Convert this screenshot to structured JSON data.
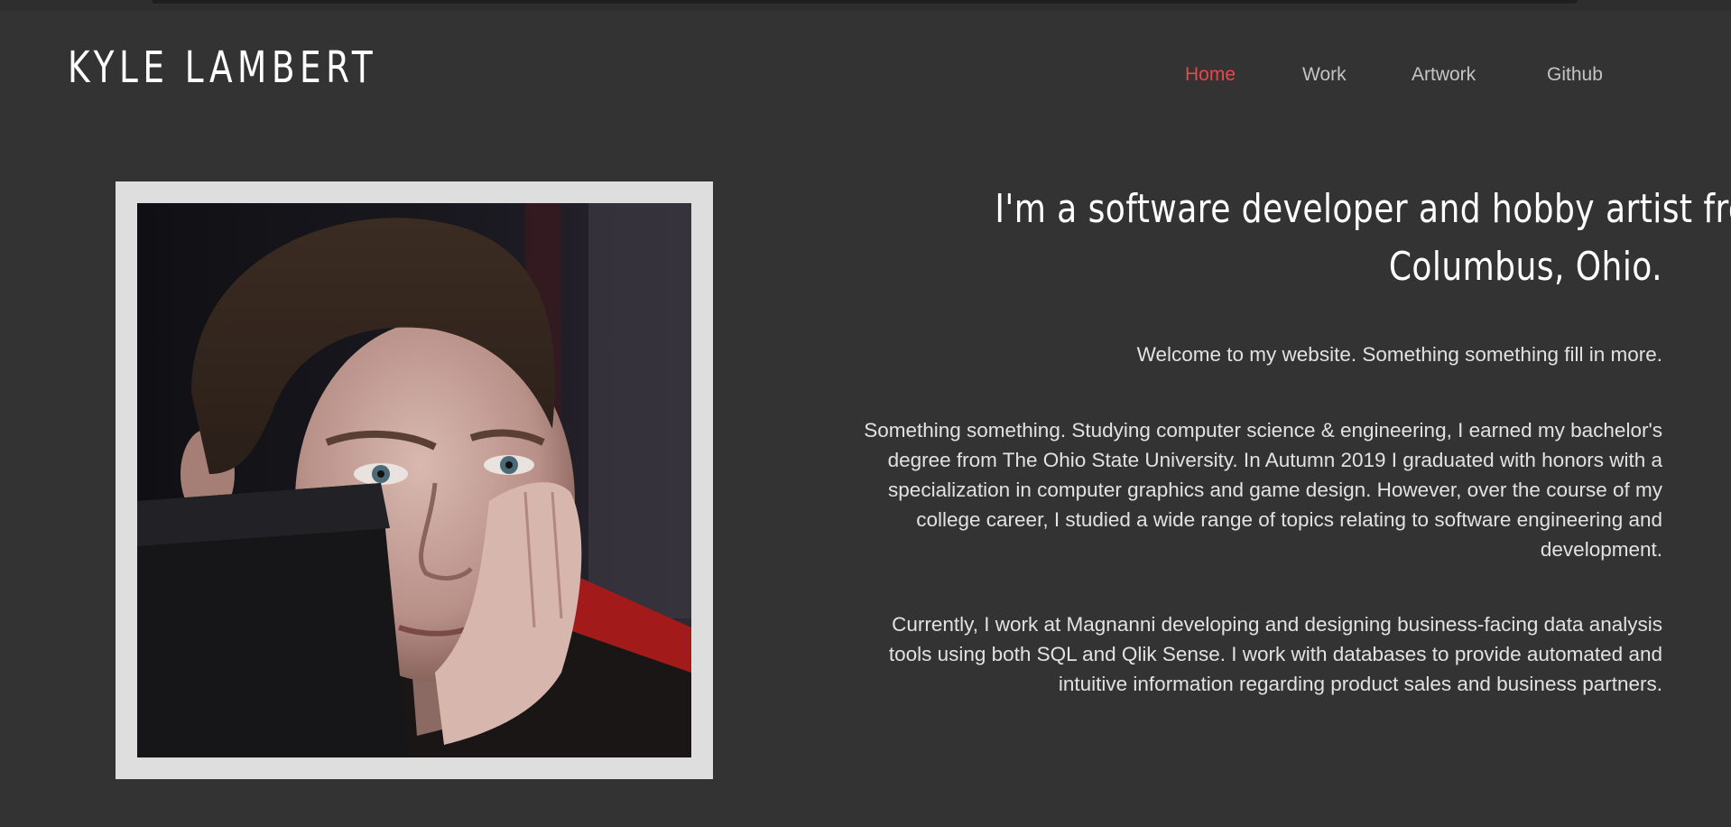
{
  "header": {
    "site_title": "KYLE LAMBERT"
  },
  "nav": {
    "items": [
      {
        "label": "Home",
        "active": true
      },
      {
        "label": "Work",
        "active": false
      },
      {
        "label": "Artwork",
        "active": false
      },
      {
        "label": "Github",
        "active": false
      }
    ]
  },
  "intro": {
    "headline_line1": "I'm a software developer and hobby artist from",
    "headline_line2": "Columbus, Ohio.",
    "welcome": "Welcome to my website. Something something fill in more.",
    "study": "Something something. Studying computer science & engineering, I earned my bachelor's degree from The Ohio State University. In Autumn 2019 I graduated with honors with a specialization in computer graphics and game design. However, over the course of my college career, I studied a wide range of topics relating to software engineering and development.",
    "work": "Currently, I work at Magnanni developing and designing business-facing data analysis tools using both SQL and Qlik Sense. I work with databases to provide automated and intuitive information regarding product sales and business partners."
  },
  "colors": {
    "background": "#333333",
    "accent": "#e8474c",
    "nav_text": "#c4c4c4",
    "frame": "#dedede"
  }
}
